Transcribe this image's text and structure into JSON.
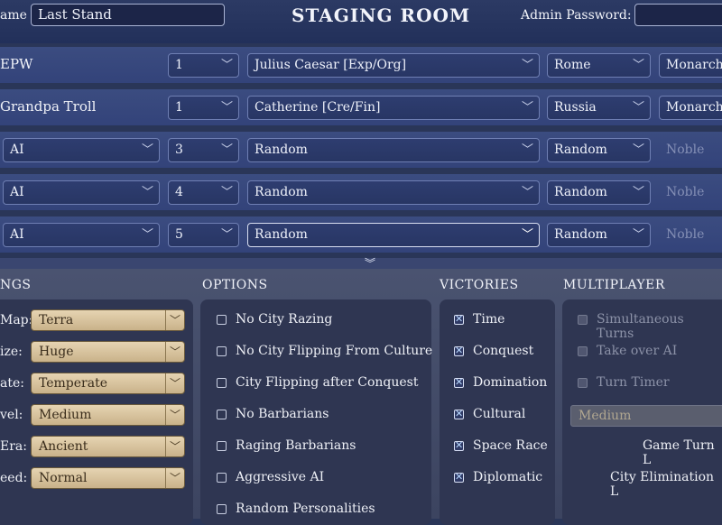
{
  "header": {
    "name_label": "ame",
    "game_name": "Last Stand",
    "title": "STAGING ROOM",
    "admin_label": "Admin Password:",
    "admin_value": ""
  },
  "players": [
    {
      "name": "EPW",
      "team": "1",
      "leader": "Julius Caesar [Exp/Org]",
      "civ": "Rome",
      "difficulty": "Monarch"
    },
    {
      "name": "Grandpa Troll",
      "team": "1",
      "leader": "Catherine [Cre/Fin]",
      "civ": "Russia",
      "difficulty": "Monarch"
    },
    {
      "name": "AI",
      "team": "3",
      "leader": "Random",
      "civ": "Random",
      "difficulty": "Noble"
    },
    {
      "name": "AI",
      "team": "4",
      "leader": "Random",
      "civ": "Random",
      "difficulty": "Noble"
    },
    {
      "name": "AI",
      "team": "5",
      "leader": "Random",
      "civ": "Random",
      "difficulty": "Noble"
    }
  ],
  "sections": {
    "settings": "NGS",
    "options": "OPTIONS",
    "victories": "VICTORIES",
    "multiplayer": "MULTIPLAYER"
  },
  "settings": [
    {
      "label": "Map:",
      "value": "Terra"
    },
    {
      "label": "ize:",
      "value": "Huge"
    },
    {
      "label": "ate:",
      "value": "Temperate"
    },
    {
      "label": "vel:",
      "value": "Medium"
    },
    {
      "label": "Era:",
      "value": "Ancient"
    },
    {
      "label": "eed:",
      "value": "Normal"
    }
  ],
  "options": [
    {
      "label": "No City Razing",
      "checked": false
    },
    {
      "label": "No City Flipping From Culture",
      "checked": false
    },
    {
      "label": "City Flipping after Conquest",
      "checked": false
    },
    {
      "label": "No Barbarians",
      "checked": false
    },
    {
      "label": "Raging Barbarians",
      "checked": false
    },
    {
      "label": "Aggressive AI",
      "checked": false
    },
    {
      "label": "Random Personalities",
      "checked": false
    }
  ],
  "victories": [
    {
      "label": "Time",
      "checked": true
    },
    {
      "label": "Conquest",
      "checked": true
    },
    {
      "label": "Domination",
      "checked": true
    },
    {
      "label": "Cultural",
      "checked": true
    },
    {
      "label": "Space Race",
      "checked": true
    },
    {
      "label": "Diplomatic",
      "checked": true
    }
  ],
  "multiplayer": {
    "options": [
      {
        "label": "Simultaneous Turns",
        "checked": false
      },
      {
        "label": "Take over AI",
        "checked": false
      },
      {
        "label": "Turn Timer",
        "checked": false
      }
    ],
    "timer_value": "Medium",
    "game_turn_label": "Game Turn L",
    "city_elim_label": "City Elimination L"
  },
  "colors": {
    "background": "#2a3658",
    "row": "#3b4c80",
    "panel": "#2f3652",
    "setting_dropdown": "#e6d4b2"
  }
}
